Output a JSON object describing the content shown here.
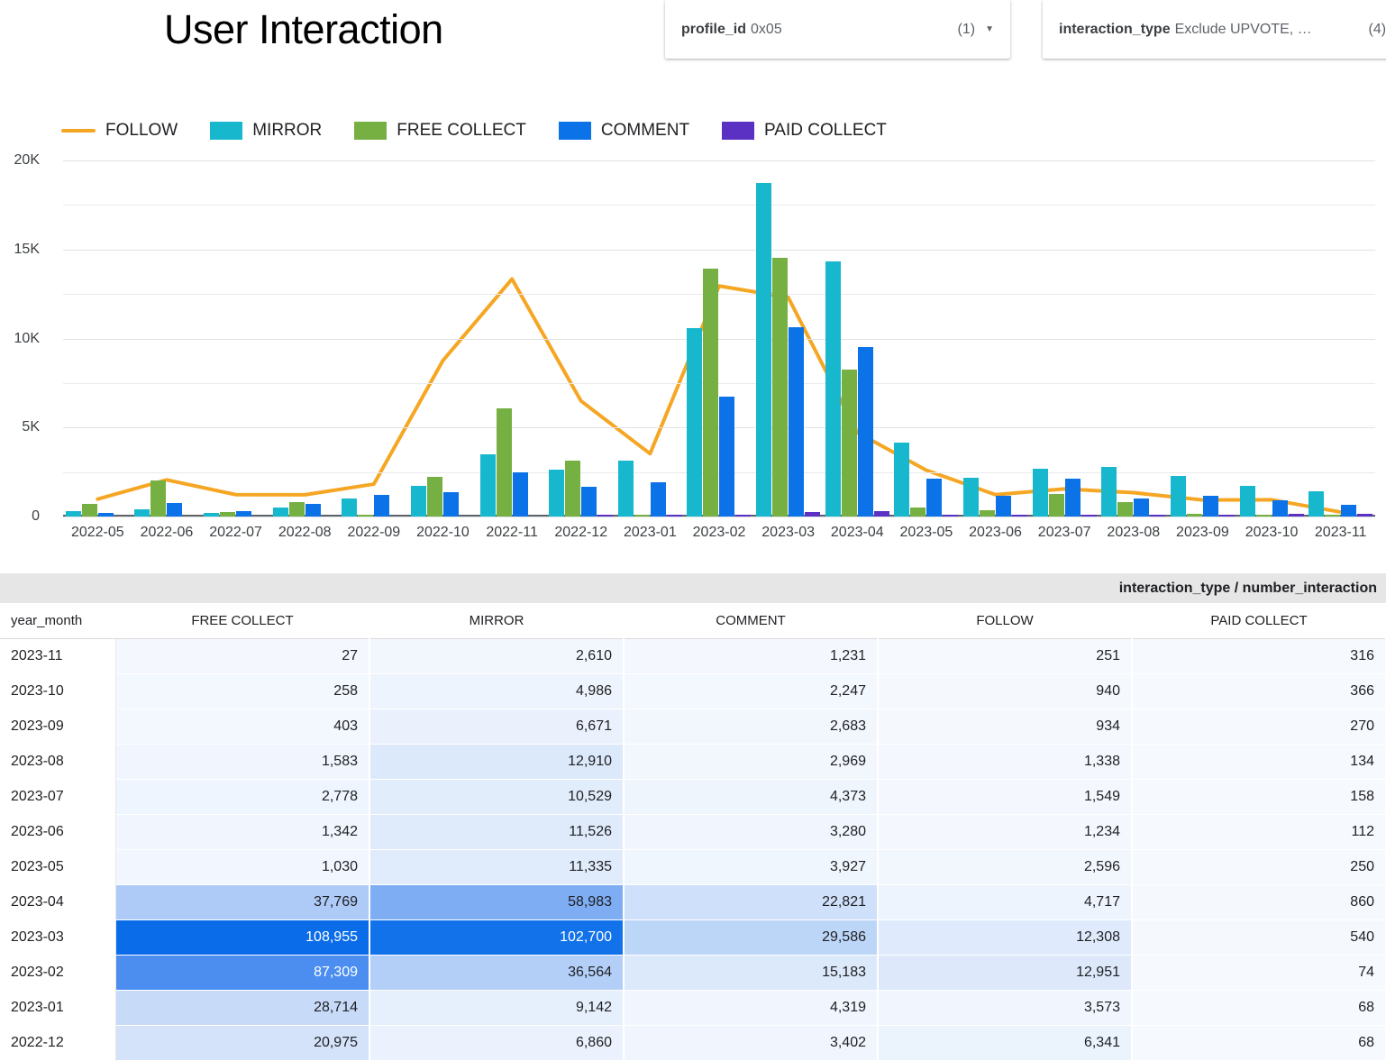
{
  "header": {
    "title": "User Interaction",
    "filters": [
      {
        "name": "profile-id",
        "label": "profile_id",
        "value": "0x05",
        "count": "(1)",
        "caret": "chevron-down-icon"
      },
      {
        "name": "interaction-type",
        "label": "interaction_type",
        "value": "Exclude UPVOTE, …",
        "count": "(4)",
        "caret": "chevron-down-icon"
      }
    ]
  },
  "chart_data": {
    "type": "bar",
    "title": "User Interaction",
    "xlabel": "",
    "ylabel": "",
    "ylim": [
      0,
      20000
    ],
    "grid": true,
    "legend_position": "top-left",
    "ytick_labels": [
      "0",
      "5K",
      "10K",
      "15K",
      "20K"
    ],
    "ytick_values": [
      0,
      5000,
      10000,
      15000,
      20000
    ],
    "categories": [
      "2022-05",
      "2022-06",
      "2022-07",
      "2022-08",
      "2022-09",
      "2022-10",
      "2022-11",
      "2022-12",
      "2023-01",
      "2023-02",
      "2023-03",
      "2023-04",
      "2023-05",
      "2023-06",
      "2023-07",
      "2023-08",
      "2023-09",
      "2023-10",
      "2023-11"
    ],
    "series": [
      {
        "name": "MIRROR",
        "type": "bar",
        "color": "#17B8CE",
        "values": [
          290,
          430,
          190,
          530,
          1020,
          1700,
          3480,
          2620,
          3120,
          10570,
          18750,
          14350,
          4130,
          2200,
          2670,
          2810,
          2300,
          1700,
          1420
        ]
      },
      {
        "name": "FREE COLLECT",
        "type": "bar",
        "color": "#76B043",
        "values": [
          700,
          2020,
          250,
          820,
          70,
          2230,
          6070,
          3150,
          120,
          13900,
          14550,
          8250,
          520,
          360,
          1250,
          820,
          160,
          110,
          30
        ]
      },
      {
        "name": "COMMENT",
        "type": "bar",
        "color": "#0B72E8",
        "values": [
          190,
          760,
          320,
          700,
          1200,
          1380,
          2490,
          1660,
          1910,
          6720,
          10650,
          9520,
          2120,
          1180,
          2130,
          1010,
          1190,
          890,
          640
        ]
      },
      {
        "name": "PAID COLLECT",
        "type": "bar",
        "color": "#5B31C4",
        "values": [
          0,
          0,
          0,
          0,
          0,
          0,
          0,
          30,
          30,
          40,
          250,
          320,
          110,
          50,
          70,
          60,
          120,
          160,
          140
        ]
      },
      {
        "name": "FOLLOW",
        "type": "line",
        "color": "#F5A623",
        "values": [
          980,
          2060,
          1230,
          1220,
          1820,
          8760,
          13340,
          6490,
          3530,
          12950,
          12310,
          4720,
          2600,
          1230,
          1550,
          1340,
          930,
          940,
          250
        ]
      }
    ]
  },
  "table": {
    "supheader": "interaction_type / number_interaction",
    "columns": [
      "year_month",
      "FREE COLLECT",
      "MIRROR",
      "COMMENT",
      "FOLLOW",
      "PAID COLLECT"
    ],
    "rows": [
      {
        "month": "2023-11",
        "values": [
          "27",
          "2,610",
          "1,231",
          "251",
          "316"
        ],
        "shades": [
          "#f4f8fe",
          "#f2f7fe",
          "#f4f8fe",
          "#f6f9fe",
          "#f6f9fe"
        ]
      },
      {
        "month": "2023-10",
        "values": [
          "258",
          "4,986",
          "2,247",
          "940",
          "366"
        ],
        "shades": [
          "#f3f7fe",
          "#eef4fd",
          "#f3f7fe",
          "#f5f9fe",
          "#f6f9fe"
        ]
      },
      {
        "month": "2023-09",
        "values": [
          "403",
          "6,671",
          "2,683",
          "934",
          "270"
        ],
        "shades": [
          "#f3f7fe",
          "#eaf1fd",
          "#f2f7fe",
          "#f5f9fe",
          "#f6f9fe"
        ]
      },
      {
        "month": "2023-08",
        "values": [
          "1,583",
          "12,910",
          "2,969",
          "1,338",
          "134"
        ],
        "shades": [
          "#f1f6fe",
          "#dce9fb",
          "#f2f7fe",
          "#f4f8fe",
          "#f6f9fe"
        ]
      },
      {
        "month": "2023-07",
        "values": [
          "2,778",
          "10,529",
          "4,373",
          "1,549",
          "158"
        ],
        "shades": [
          "#eff5fe",
          "#e2edfc",
          "#eff5fd",
          "#f4f8fe",
          "#f6f9fe"
        ]
      },
      {
        "month": "2023-06",
        "values": [
          "1,342",
          "11,526",
          "3,280",
          "1,234",
          "112"
        ],
        "shades": [
          "#f1f6fe",
          "#dfebfb",
          "#f1f6fe",
          "#f4f8fe",
          "#f6f9fe"
        ]
      },
      {
        "month": "2023-05",
        "values": [
          "1,030",
          "11,335",
          "3,927",
          "2,596",
          "250"
        ],
        "shades": [
          "#f2f6fe",
          "#e0ecfc",
          "#f0f6fe",
          "#f2f7fe",
          "#f6f9fe"
        ]
      },
      {
        "month": "2023-04",
        "values": [
          "37,769",
          "58,983",
          "22,821",
          "4,717",
          "860"
        ],
        "shades": [
          "#aecbf7",
          "#7ead f4",
          "#cfe0fa",
          "#eef4fd",
          "#f5f9fe"
        ]
      },
      {
        "month": "2023-03",
        "values": [
          "108,955",
          "102,700",
          "29,586",
          "12,308",
          "540"
        ],
        "shades": [
          "#0a6ce8",
          "#1272ea",
          "#bcd6f8",
          "#dfebfc",
          "#f5f9fe"
        ]
      },
      {
        "month": "2023-02",
        "values": [
          "87,309",
          "36,564",
          "15,183",
          "12,951",
          "74"
        ],
        "shades": [
          "#4b8ef0",
          "#b3cef7",
          "#dbe9fb",
          "#dde9fb",
          "#f6f9fe"
        ]
      },
      {
        "month": "2023-01",
        "values": [
          "28,714",
          "9,142",
          "4,319",
          "3,573",
          "68"
        ],
        "shades": [
          "#c7dbf9",
          "#e6f0fd",
          "#f0f5fe",
          "#f1f6fe",
          "#f6f9fe"
        ]
      },
      {
        "month": "2022-12",
        "values": [
          "20,975",
          "6,860",
          "3,402",
          "6,341",
          "68"
        ],
        "shades": [
          "#d4e3fa",
          "#ebf2fd",
          "#f1f6fe",
          "#ebf3fd",
          "#f6f9fe"
        ]
      }
    ]
  }
}
